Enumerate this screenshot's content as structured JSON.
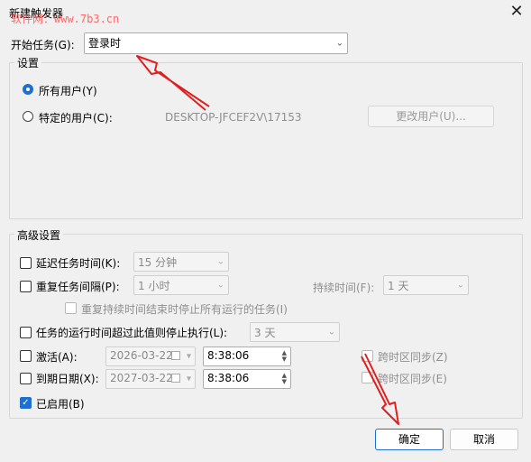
{
  "window": {
    "title": "新建触发器",
    "watermark": "软件网：www.7b3.cn",
    "close_glyph": "✕"
  },
  "start_task": {
    "label": "开始任务(G):",
    "value": "登录时"
  },
  "settings": {
    "title": "设置",
    "all_users_label": "所有用户(Y)",
    "specific_user_label": "特定的用户(C):",
    "user_value": "DESKTOP-JFCEF2V\\17153",
    "change_user_button": "更改用户(U)..."
  },
  "advanced": {
    "title": "高级设置",
    "delay": {
      "label": "延迟任务时间(K):",
      "value": "15 分钟"
    },
    "repeat": {
      "label": "重复任务间隔(P):",
      "value": "1 小时"
    },
    "duration": {
      "label": "持续时间(F):",
      "value": "1 天"
    },
    "stop_all": {
      "label": "重复持续时间结束时停止所有运行的任务(I)"
    },
    "stop_if_longer": {
      "label": "任务的运行时间超过此值则停止执行(L):",
      "value": "3 天"
    },
    "activate": {
      "label": "激活(A):",
      "date": "2026-03-22",
      "time": "8:38:06",
      "sync_label": "跨时区同步(Z)"
    },
    "expire": {
      "label": "到期日期(X):",
      "date": "2027-03-22",
      "time": "8:38:06",
      "sync_label": "跨时区同步(E)"
    },
    "enabled": {
      "label": "已启用(B)",
      "checkmark": "✓"
    }
  },
  "buttons": {
    "ok": "确定",
    "cancel": "取消"
  },
  "colors": {
    "accent": "#1f6fd0",
    "annotation_arrow": "#e02020"
  }
}
